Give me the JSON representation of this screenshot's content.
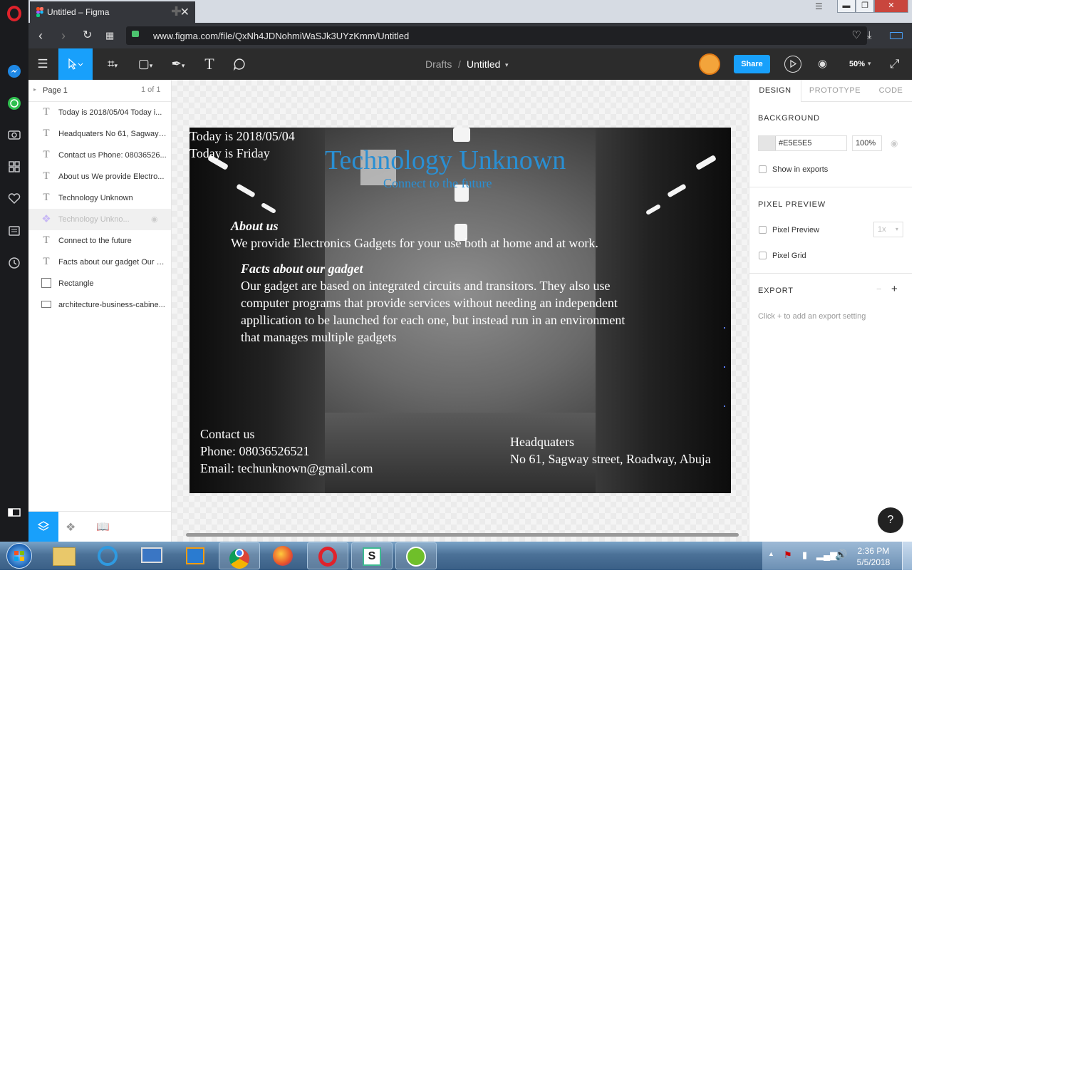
{
  "browser": {
    "tab_title": "Untitled – Figma",
    "url": "www.figma.com/file/QxNh4JDNohmiWaSJk3UYzKmm/Untitled"
  },
  "toolbar": {
    "breadcrumb_root": "Drafts",
    "breadcrumb_sep": "/",
    "file_name": "Untitled",
    "share_label": "Share",
    "zoom": "50%"
  },
  "layers_panel": {
    "page_name": "Page 1",
    "page_count": "1 of 1",
    "layers": [
      {
        "name": "Today is 2018/05/04 Today i...",
        "icon": "T"
      },
      {
        "name": "Headquaters No 61, Sagway ...",
        "icon": "T"
      },
      {
        "name": "Contact us Phone: 08036526...",
        "icon": "T"
      },
      {
        "name": "About us We provide Electro...",
        "icon": "T"
      },
      {
        "name": "Technology Unknown",
        "icon": "T"
      },
      {
        "name": "Technology Unkno...",
        "icon": "component"
      },
      {
        "name": "Connect to the future",
        "icon": "T"
      },
      {
        "name": "Facts about our gadget Our g...",
        "icon": "T"
      },
      {
        "name": "Rectangle",
        "icon": "rect"
      },
      {
        "name": "architecture-business-cabine...",
        "icon": "image"
      }
    ]
  },
  "frame": {
    "date_line1": "Today is 2018/05/04",
    "date_line2": "Today is Friday",
    "title": "Technology Unknown",
    "subtitle": "Connect to the future",
    "about_heading": "About us",
    "about_text": "We provide Electronics Gadgets for your use both at home and at work.",
    "facts_heading": "Facts about our gadget",
    "facts_lines": [
      "Our gadget are based on integrated circuits and transitors. They also use",
      "computer programs that provide services without needing an independent",
      "appllication to be launched for each one, but instead run in an environment",
      "that manages multiple gadgets"
    ],
    "contact_heading": "Contact us",
    "contact_phone": "Phone: 08036526521",
    "contact_email": "Email: techunknown@gmail.com",
    "hq_heading": "Headquaters",
    "hq_address": "No 61, Sagway street,  Roadway, Abuja"
  },
  "design_panel": {
    "tabs": [
      "DESIGN",
      "PROTOTYPE",
      "CODE"
    ],
    "background_label": "BACKGROUND",
    "bg_hex": "#E5E5E5",
    "bg_opacity": "100%",
    "show_in_exports": "Show in exports",
    "pixel_preview_header": "PIXEL PREVIEW",
    "pixel_preview": "Pixel Preview",
    "pixel_scale": "1x",
    "pixel_grid": "Pixel Grid",
    "export_header": "EXPORT",
    "export_hint": "Click + to add an export setting",
    "help": "?"
  },
  "taskbar": {
    "time": "2:36 PM",
    "date": "5/5/2018"
  },
  "colors": {
    "accent": "#18a0fb",
    "title_blue": "#2a8fd3",
    "avatar": "#f3a43b"
  }
}
